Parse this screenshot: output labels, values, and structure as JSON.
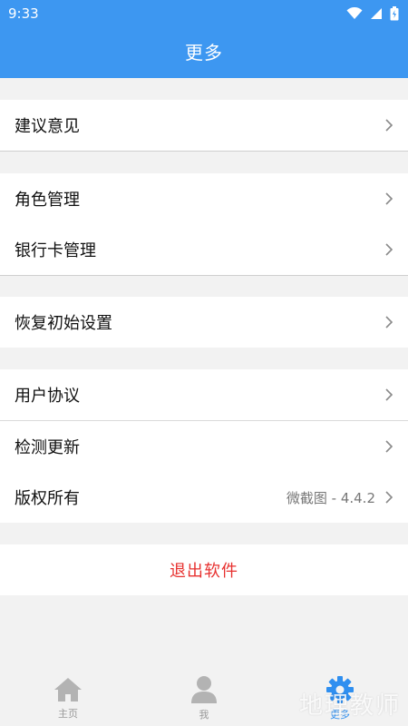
{
  "status": {
    "time": "9:33"
  },
  "header": {
    "title": "更多"
  },
  "groups": {
    "feedback": {
      "label": "建议意见"
    },
    "roles": {
      "label": "角色管理"
    },
    "bank": {
      "label": "银行卡管理"
    },
    "reset": {
      "label": "恢复初始设置"
    },
    "agreement": {
      "label": "用户协议"
    },
    "update": {
      "label": "检测更新"
    },
    "copyright": {
      "label": "版权所有",
      "value": "微截图 - 4.4.2"
    }
  },
  "exit": {
    "label": "退出软件"
  },
  "tabbar": {
    "home": "主页",
    "me": "我",
    "more": "更多"
  },
  "watermark": {
    "text": "地理教师"
  },
  "colors": {
    "accent": "#3d97f1",
    "danger": "#e7312f",
    "active_tab": "#2f8ff0"
  },
  "icons": [
    "wifi-icon",
    "signal-icon",
    "battery-icon",
    "chevron-right-icon",
    "home-icon",
    "user-icon",
    "gear-icon"
  ]
}
